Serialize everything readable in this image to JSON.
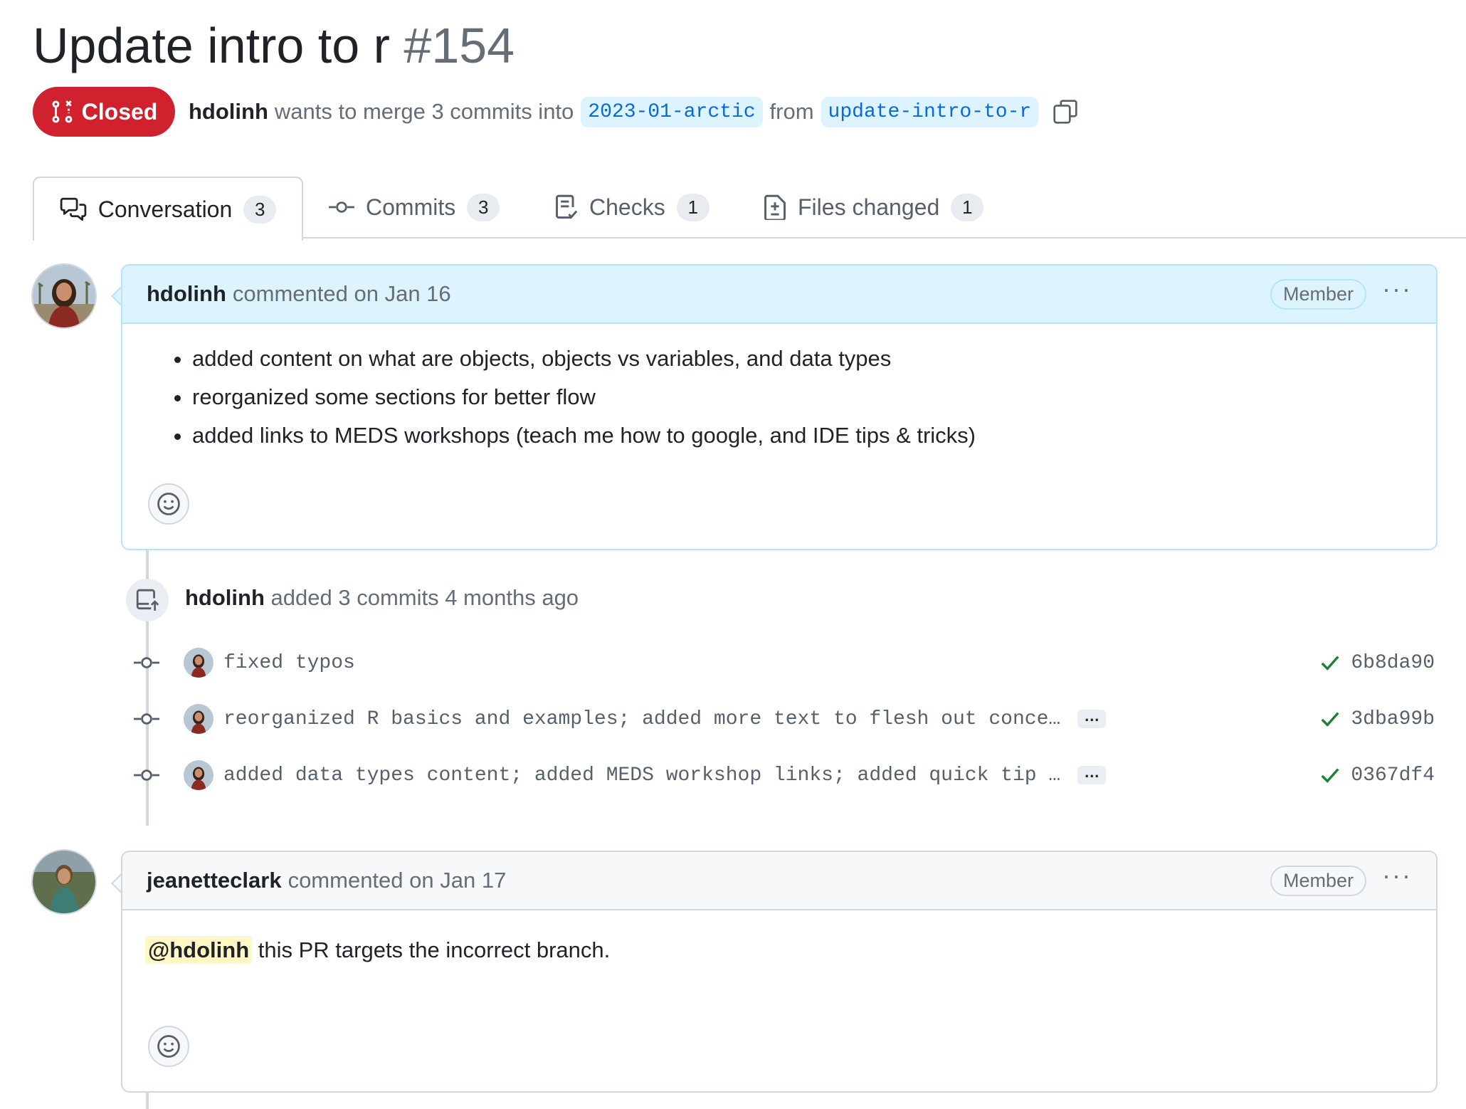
{
  "pr": {
    "title": "Update intro to r",
    "number": "#154",
    "state": "Closed",
    "author": "hdolinh",
    "summary_pre": "wants to merge 3 commits into",
    "base_branch": "2023-01-arctic",
    "summary_mid": "from",
    "head_branch": "update-intro-to-r"
  },
  "tabs": [
    {
      "label": "Conversation",
      "count": "3"
    },
    {
      "label": "Commits",
      "count": "3"
    },
    {
      "label": "Checks",
      "count": "1"
    },
    {
      "label": "Files changed",
      "count": "1"
    }
  ],
  "comments": [
    {
      "author": "hdolinh",
      "meta": "commented on Jan 16",
      "role": "Member",
      "bullets": [
        "added content on what are objects, objects vs variables, and data types",
        "reorganized some sections for better flow",
        "added links to MEDS workshops (teach me how to google, and IDE tips & tricks)"
      ]
    },
    {
      "author": "jeanetteclark",
      "meta": "commented on Jan 17",
      "role": "Member",
      "mention": "@hdolinh",
      "text": " this PR targets the incorrect branch."
    }
  ],
  "commit_event": {
    "author": "hdolinh",
    "text": "added 3 commits 4 months ago",
    "commits": [
      {
        "message": "fixed typos",
        "sha": "6b8da90",
        "more": ""
      },
      {
        "message": "reorganized R basics and examples; added more text to flesh out conce…",
        "sha": "3dba99b",
        "more": "…"
      },
      {
        "message": "added data types content; added MEDS workshop links; added quick tip …",
        "sha": "0367df4",
        "more": "…"
      }
    ]
  },
  "colors": {
    "closed": "#cf222e",
    "link": "#0969da",
    "branch_bg": "#ddf4ff",
    "success": "#1a7f37",
    "mention_bg": "#fff8c5"
  },
  "icons": [
    "git-pull-request-closed-icon",
    "copy-icon",
    "comment-discussion-icon",
    "git-commit-icon",
    "checklist-icon",
    "file-diff-icon",
    "kebab-horizontal-icon",
    "smiley-icon",
    "repo-push-icon",
    "check-icon"
  ]
}
